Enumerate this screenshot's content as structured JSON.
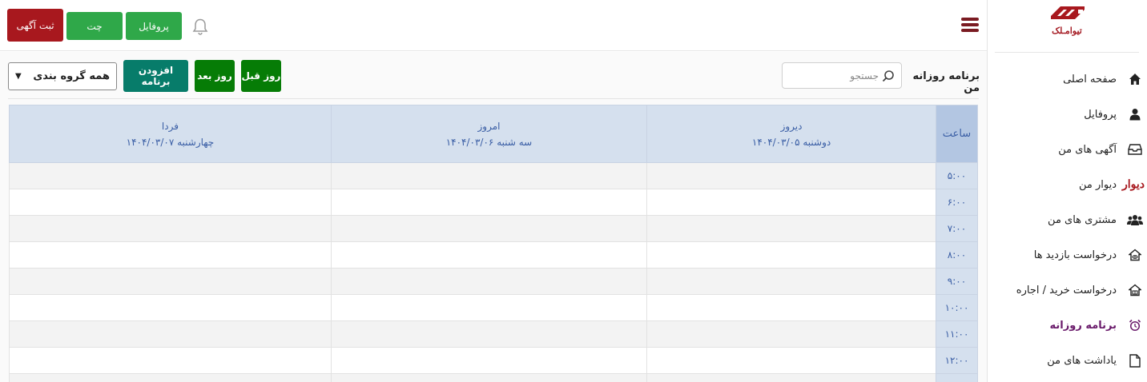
{
  "brand": {
    "logo_text": "تیوامـلک"
  },
  "topbar": {
    "post_ad_label": "ثبت آگهی",
    "chat_label": "چت",
    "profile_label": "پروفایل"
  },
  "sidebar": {
    "items": [
      {
        "label": "صفحه اصلی",
        "icon": "home-icon"
      },
      {
        "label": "پروفایل",
        "icon": "user-icon"
      },
      {
        "label": "آگهی های من",
        "icon": "inbox-icon"
      },
      {
        "label": "دیوار من",
        "icon": "divar-logo",
        "icon_text": "دیوار"
      },
      {
        "label": "مشتری های من",
        "icon": "users-icon"
      },
      {
        "label": "درخواست بازدید ها",
        "icon": "house-eye-icon"
      },
      {
        "label": "درخواست خرید / اجاره",
        "icon": "house-store-icon"
      },
      {
        "label": "برنامه روزانه",
        "icon": "alarm-clock-icon",
        "active": true
      },
      {
        "label": "یاداشت های من",
        "icon": "file-icon"
      }
    ]
  },
  "toolbar": {
    "title": "برنامه روزانه من",
    "search_placeholder": "جستجو",
    "prev_day_label": "روز قبل",
    "next_day_label": "روز بعد",
    "add_program_label": "افزودن برنامه",
    "group_select_value": "همه گروه بندی"
  },
  "schedule": {
    "hour_header": "ساعت",
    "days": [
      {
        "name": "دیروز",
        "date": "دوشنبه ۱۴۰۴/۰۳/۰۵"
      },
      {
        "name": "امروز",
        "date": "سه شنبه ۱۴۰۴/۰۳/۰۶"
      },
      {
        "name": "فردا",
        "date": "چهارشنبه ۱۴۰۴/۰۳/۰۷"
      }
    ],
    "hours": [
      "۵:۰۰",
      "۶:۰۰",
      "۷:۰۰",
      "۸:۰۰",
      "۹:۰۰",
      "۱۰:۰۰",
      "۱۱:۰۰",
      "۱۲:۰۰",
      "۱۳:۰۰"
    ]
  },
  "colors": {
    "brand_red": "#a8181e",
    "green": "#2fa849",
    "dark_green": "#067c06",
    "teal": "#077c6a",
    "active_purple": "#6a1b6b",
    "header_blue": "#d5e0ee"
  }
}
